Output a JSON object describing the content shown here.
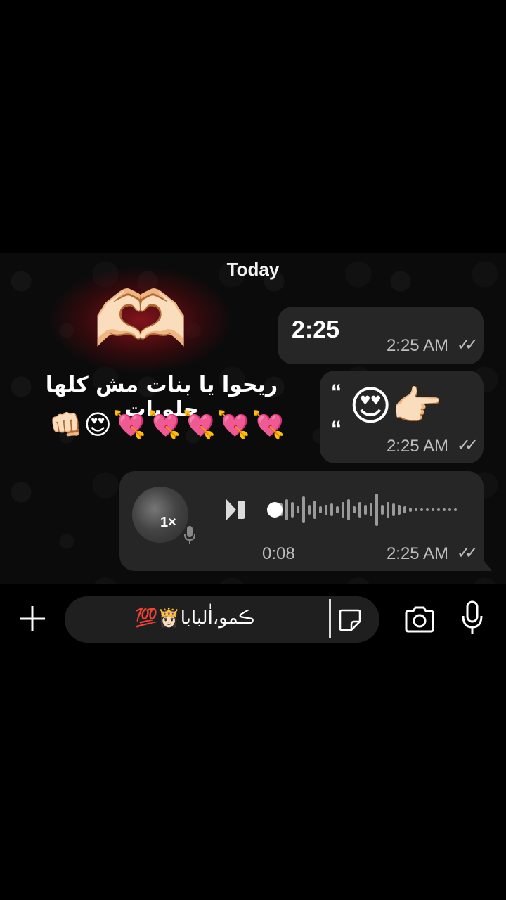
{
  "chat": {
    "date_label": "Today",
    "overlay": {
      "heart_emoji": "🫶🏻",
      "arabic_text": "ريحوا يا بنات مش كلها حلويات",
      "emoji_row": "👊🏻😍💘💘💘💘💘"
    },
    "messages": [
      {
        "text": "2:25",
        "time": "2:25 AM",
        "status": "read"
      },
      {
        "quote_open": "“",
        "quote_close": "“",
        "emojis": "😍👉🏻",
        "time": "2:25 AM",
        "status": "read"
      },
      {
        "type": "voice",
        "speed": "1×",
        "duration": "0:08",
        "time": "2:25 AM",
        "status": "read"
      }
    ]
  },
  "input": {
    "text": "ڪمو،اٰلبابا👸🏻💯"
  },
  "ticks_glyph": "✓✓",
  "colors": {
    "background": "#000000",
    "bubble": "#262626",
    "meta_text": "#bdbdbd",
    "input_bg": "#1f1f1f"
  }
}
